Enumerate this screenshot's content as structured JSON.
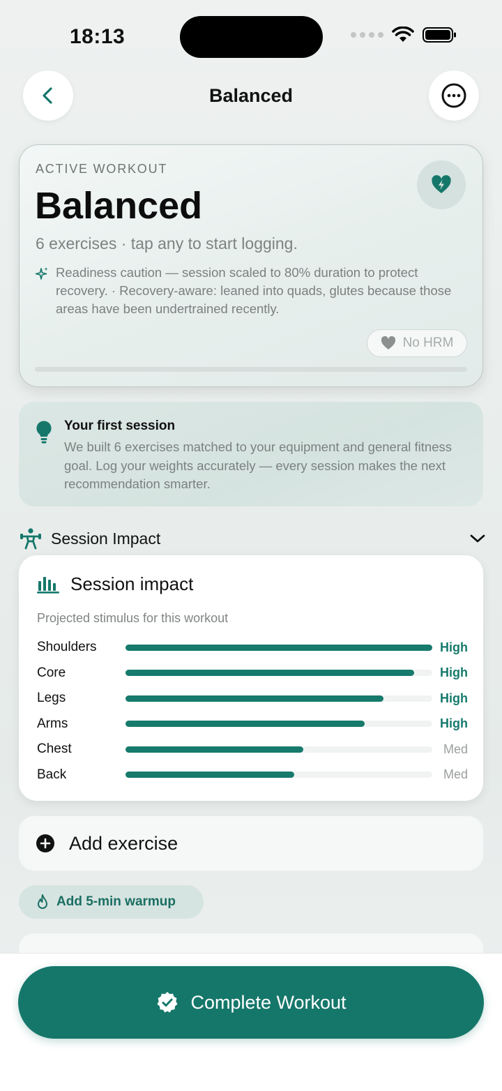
{
  "status_bar": {
    "time": "18:13"
  },
  "nav": {
    "title": "Balanced",
    "back_icon": "chevron-left-icon",
    "more_icon": "ellipsis-circle-icon"
  },
  "active_workout": {
    "eyebrow": "ACTIVE WORKOUT",
    "title": "Balanced",
    "subtitle": "6 exercises · tap any to start logging.",
    "note": "Readiness caution — session scaled to 80% duration to protect recovery. · Recovery-aware: leaned into quads, glutes because those areas have been undertrained recently.",
    "hrm_label": "No HRM",
    "progress": 0
  },
  "first_session": {
    "title": "Your first session",
    "body": "We built 6 exercises matched to your equipment and general fitness goal. Log your weights accurately — every session makes the next recommendation smarter."
  },
  "impact_section": {
    "label": "Session Impact"
  },
  "impact_card": {
    "title": "Session impact",
    "subtitle": "Projected stimulus for this workout",
    "rows": [
      {
        "label": "Shoulders",
        "level": "High",
        "value": 1.0
      },
      {
        "label": "Core",
        "level": "High",
        "value": 0.94
      },
      {
        "label": "Legs",
        "level": "High",
        "value": 0.84
      },
      {
        "label": "Arms",
        "level": "High",
        "value": 0.78
      },
      {
        "label": "Chest",
        "level": "Med",
        "value": 0.58
      },
      {
        "label": "Back",
        "level": "Med",
        "value": 0.55
      }
    ]
  },
  "add_exercise": {
    "label": "Add exercise"
  },
  "warmup": {
    "label": "Add 5-min warmup"
  },
  "footer": {
    "complete_label": "Complete Workout"
  },
  "colors": {
    "accent": "#15776a",
    "high": "#167a6c",
    "med": "#9a9f9e"
  }
}
